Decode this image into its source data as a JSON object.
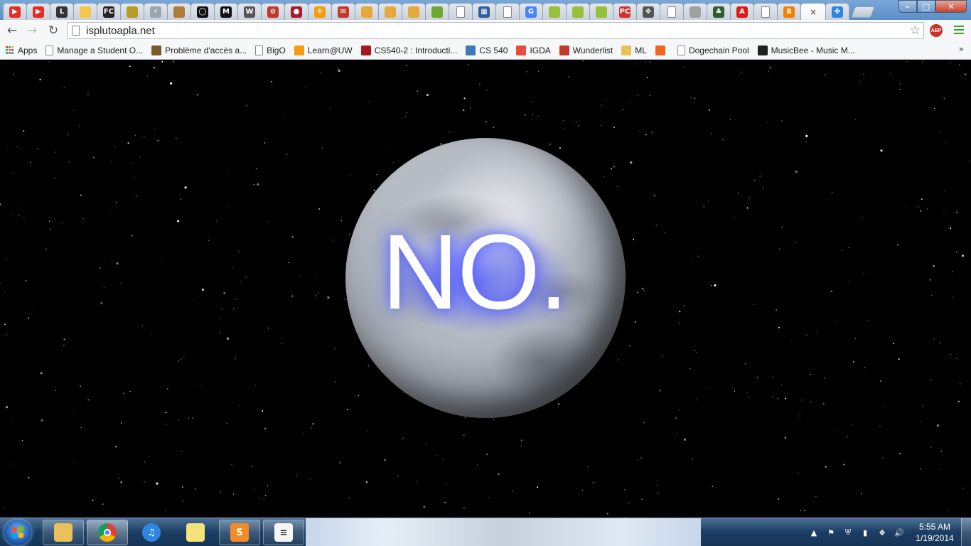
{
  "browser": {
    "tabs": [
      {
        "icon": "youtube-icon",
        "glyph": "▶",
        "color": "#e52d27"
      },
      {
        "icon": "youtube-icon",
        "glyph": "▶",
        "color": "#e52d27"
      },
      {
        "icon": "l-icon",
        "glyph": "L",
        "color": "#333333"
      },
      {
        "icon": "yellow-box-icon",
        "glyph": "",
        "color": "#f2c94c"
      },
      {
        "icon": "fc-icon",
        "glyph": "FC",
        "color": "#222222"
      },
      {
        "icon": "archive-icon",
        "glyph": "",
        "color": "#b59b2a"
      },
      {
        "icon": "compass-icon",
        "glyph": "✧",
        "color": "#9aa5b1"
      },
      {
        "icon": "monkey-icon",
        "glyph": "",
        "color": "#b07a3a"
      },
      {
        "icon": "ring-icon",
        "glyph": "◯",
        "color": "#111111"
      },
      {
        "icon": "m-icon",
        "glyph": "M",
        "color": "#111111"
      },
      {
        "icon": "wsj-icon",
        "glyph": "W",
        "color": "#555555"
      },
      {
        "icon": "no-sign-icon",
        "glyph": "⊘",
        "color": "#c0392b"
      },
      {
        "icon": "red-dot-icon",
        "glyph": "●",
        "color": "#a51d2d"
      },
      {
        "icon": "asterisk-icon",
        "glyph": "✳",
        "color": "#f39c12"
      },
      {
        "icon": "mail-icon",
        "glyph": "✉",
        "color": "#c0392b"
      },
      {
        "icon": "package-icon",
        "glyph": "",
        "color": "#e5a93b"
      },
      {
        "icon": "package-icon",
        "glyph": "",
        "color": "#e5a93b"
      },
      {
        "icon": "package-icon",
        "glyph": "",
        "color": "#e5a93b"
      },
      {
        "icon": "green-leaf-icon",
        "glyph": "",
        "color": "#6fa830"
      },
      {
        "icon": "document-icon",
        "glyph": "",
        "color": "#ffffff"
      },
      {
        "icon": "grid-icon",
        "glyph": "▦",
        "color": "#2f5e9e"
      },
      {
        "icon": "document-icon",
        "glyph": "",
        "color": "#ffffff"
      },
      {
        "icon": "google-icon",
        "glyph": "G",
        "color": "#4285f4"
      },
      {
        "icon": "android-icon",
        "glyph": "",
        "color": "#97c03d"
      },
      {
        "icon": "android-icon",
        "glyph": "",
        "color": "#97c03d"
      },
      {
        "icon": "android-icon",
        "glyph": "",
        "color": "#97c03d"
      },
      {
        "icon": "pc-icon",
        "glyph": "PC",
        "color": "#d0312d"
      },
      {
        "icon": "puzzle-icon",
        "glyph": "✥",
        "color": "#555555"
      },
      {
        "icon": "document-icon",
        "glyph": "",
        "color": "#ffffff"
      },
      {
        "icon": "cat-icon",
        "glyph": "",
        "color": "#a0a0a0"
      },
      {
        "icon": "tree-icon",
        "glyph": "♣",
        "color": "#2d5f2e"
      },
      {
        "icon": "angular-icon",
        "glyph": "A",
        "color": "#dd1b16"
      },
      {
        "icon": "document-icon",
        "glyph": "",
        "color": "#ffffff"
      },
      {
        "icon": "blogger-icon",
        "glyph": "B",
        "color": "#f57d00"
      },
      {
        "icon": "close-icon",
        "glyph": "×",
        "color": "",
        "active": true
      },
      {
        "icon": "pinwheel-icon",
        "glyph": "✤",
        "color": "#2e86de"
      }
    ],
    "window_controls": {
      "minimize": "–",
      "maximize": "□",
      "close": "✕"
    },
    "url": "isplutoapla.net",
    "abp_label": "ABP",
    "bookmarks": {
      "apps": "Apps",
      "items": [
        {
          "label": "Manage a Student O...",
          "icon": "document-icon",
          "color": ""
        },
        {
          "label": "Problème d'accès a...",
          "icon": "photo-icon",
          "color": "#7a5a2a"
        },
        {
          "label": "BigO",
          "icon": "document-icon",
          "color": ""
        },
        {
          "label": "Learn@UW",
          "icon": "asterisk-icon",
          "color": "#f39c12"
        },
        {
          "label": "CS540-2 : Introducti...",
          "icon": "crest-icon",
          "color": "#a5191e"
        },
        {
          "label": "CS 540",
          "icon": "p-icon",
          "color": "#3d7bb8"
        },
        {
          "label": "IGDA",
          "icon": "igda-icon",
          "color": "#e74c3c"
        },
        {
          "label": "Wunderlist",
          "icon": "wunderlist-icon",
          "color": "#c0392b"
        },
        {
          "label": "ML",
          "icon": "folder-icon",
          "color": "#e8c15a"
        },
        {
          "label": "",
          "icon": "y-icon",
          "color": "#f26522"
        },
        {
          "label": "Dogechain Pool",
          "icon": "document-icon",
          "color": ""
        },
        {
          "label": "MusicBee - Music M...",
          "icon": "musicbee-icon",
          "color": "#222222"
        }
      ],
      "more": "»"
    }
  },
  "page": {
    "answer": "NO."
  },
  "taskbar": {
    "apps": [
      {
        "name": "explorer-icon",
        "glyph": "",
        "color": "#e8c15a",
        "active": false
      },
      {
        "name": "chrome-icon",
        "glyph": "",
        "color": "#4285f4",
        "active": true
      },
      {
        "name": "itunes-icon",
        "glyph": "♫",
        "color": "#2e86de",
        "active": false
      },
      {
        "name": "sticky-notes-icon",
        "glyph": "",
        "color": "#f4e27a",
        "active": false
      },
      {
        "name": "sublime-text-icon",
        "glyph": "S",
        "color": "#f28c28",
        "active": false
      },
      {
        "name": "notepad-icon",
        "glyph": "≡",
        "color": "#f5f5f5",
        "active": false
      }
    ],
    "tray": [
      {
        "name": "show-hidden-icon",
        "glyph": "▲"
      },
      {
        "name": "action-center-icon",
        "glyph": "⚑"
      },
      {
        "name": "defender-icon",
        "glyph": "⛨"
      },
      {
        "name": "network-icon",
        "glyph": "▮"
      },
      {
        "name": "dropbox-icon",
        "glyph": "❖"
      },
      {
        "name": "volume-icon",
        "glyph": "🔊"
      }
    ],
    "clock": {
      "time": "5:55 AM",
      "date": "1/19/2014"
    }
  }
}
